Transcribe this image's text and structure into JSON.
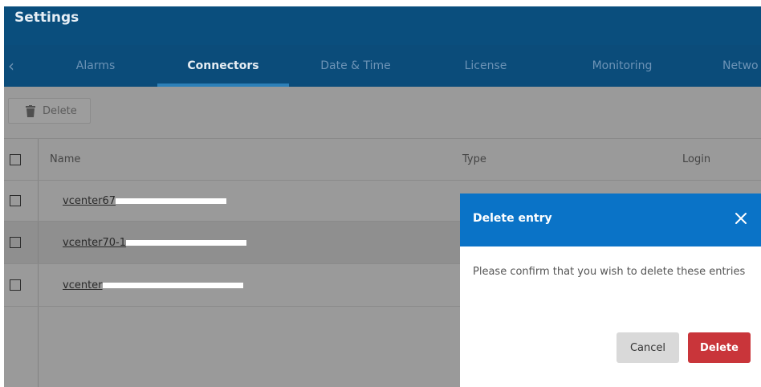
{
  "header": {
    "title": "Settings"
  },
  "tabs": [
    {
      "label": "Alarms"
    },
    {
      "label": "Connectors"
    },
    {
      "label": "Date & Time"
    },
    {
      "label": "License"
    },
    {
      "label": "Monitoring"
    },
    {
      "label": "Netwo"
    }
  ],
  "toolbar": {
    "delete_label": "Delete"
  },
  "table": {
    "columns": [
      "Name",
      "Type",
      "Login"
    ],
    "rows": [
      {
        "name": "vcenter67"
      },
      {
        "name": "vcenter70-1"
      },
      {
        "name": "vcenter"
      }
    ]
  },
  "dialog": {
    "title": "Delete entry",
    "message": "Please confirm that you wish to delete these entries",
    "cancel_label": "Cancel",
    "delete_label": "Delete"
  }
}
